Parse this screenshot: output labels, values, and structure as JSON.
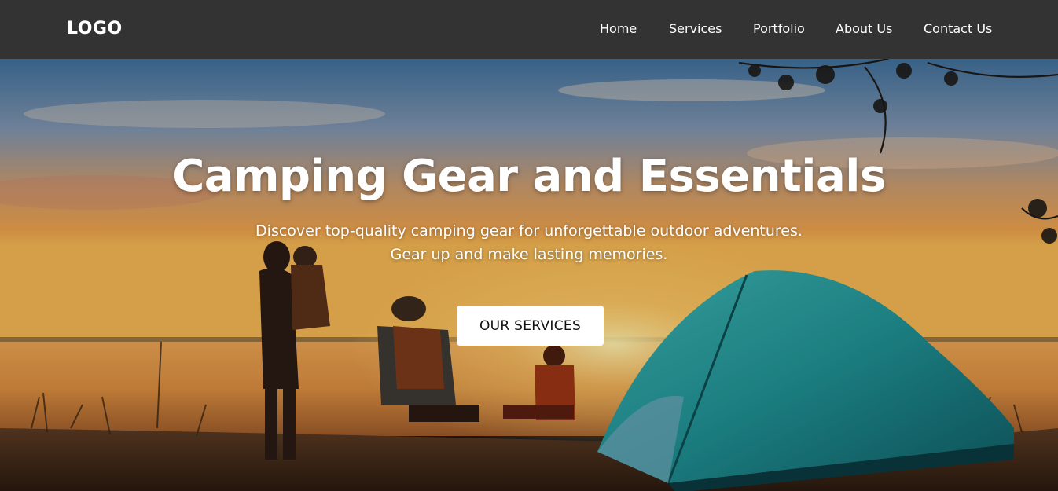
{
  "header": {
    "logo": "LOGO",
    "nav": {
      "home": "Home",
      "services": "Services",
      "portfolio": "Portfolio",
      "about": "About Us",
      "contact": "Contact Us"
    }
  },
  "hero": {
    "title": "Camping Gear and Essentials",
    "subtitle_line1": "Discover top-quality camping gear for unforgettable outdoor adventures.",
    "subtitle_line2": "Gear up and make lasting memories.",
    "cta_label": "OUR SERVICES"
  },
  "colors": {
    "navbar_bg": "#333333",
    "text_light": "#ffffff",
    "button_bg": "#ffffff",
    "button_text": "#111111",
    "tent": "#1f9a9c"
  }
}
